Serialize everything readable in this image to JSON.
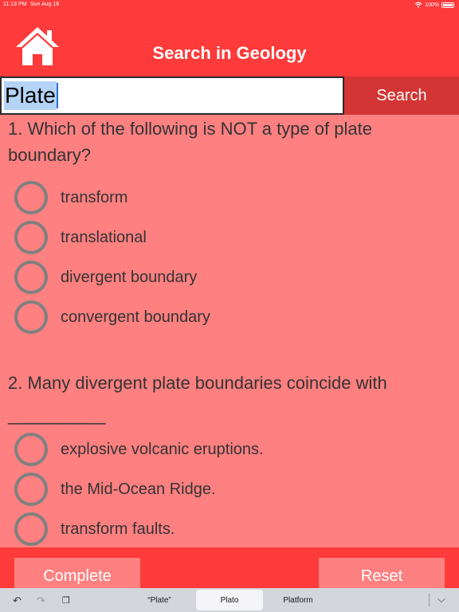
{
  "status_bar": {
    "time": "11:13 PM",
    "date": "Sun Aug 18",
    "battery": "100%"
  },
  "header": {
    "title": "Search in Geology",
    "home_icon": "home-icon"
  },
  "search": {
    "value": "Plate",
    "button_label": "Search"
  },
  "questions": [
    {
      "text": "1. Which of the following is NOT a type of plate boundary?",
      "options": [
        "transform",
        "translational",
        "divergent boundary",
        "convergent boundary"
      ]
    },
    {
      "text": "2. Many divergent plate boundaries coincide with __________",
      "options": [
        "explosive volcanic eruptions.",
        "the Mid-Ocean Ridge.",
        "transform faults."
      ]
    }
  ],
  "actions": {
    "complete_label": "Complete",
    "reset_label": "Reset"
  },
  "keyboard": {
    "suggestions": [
      "“Plate”",
      "Plato",
      "Platform"
    ]
  },
  "colors": {
    "header": "#fe3a3a",
    "background": "#ff8080",
    "search_button": "#d33434"
  }
}
